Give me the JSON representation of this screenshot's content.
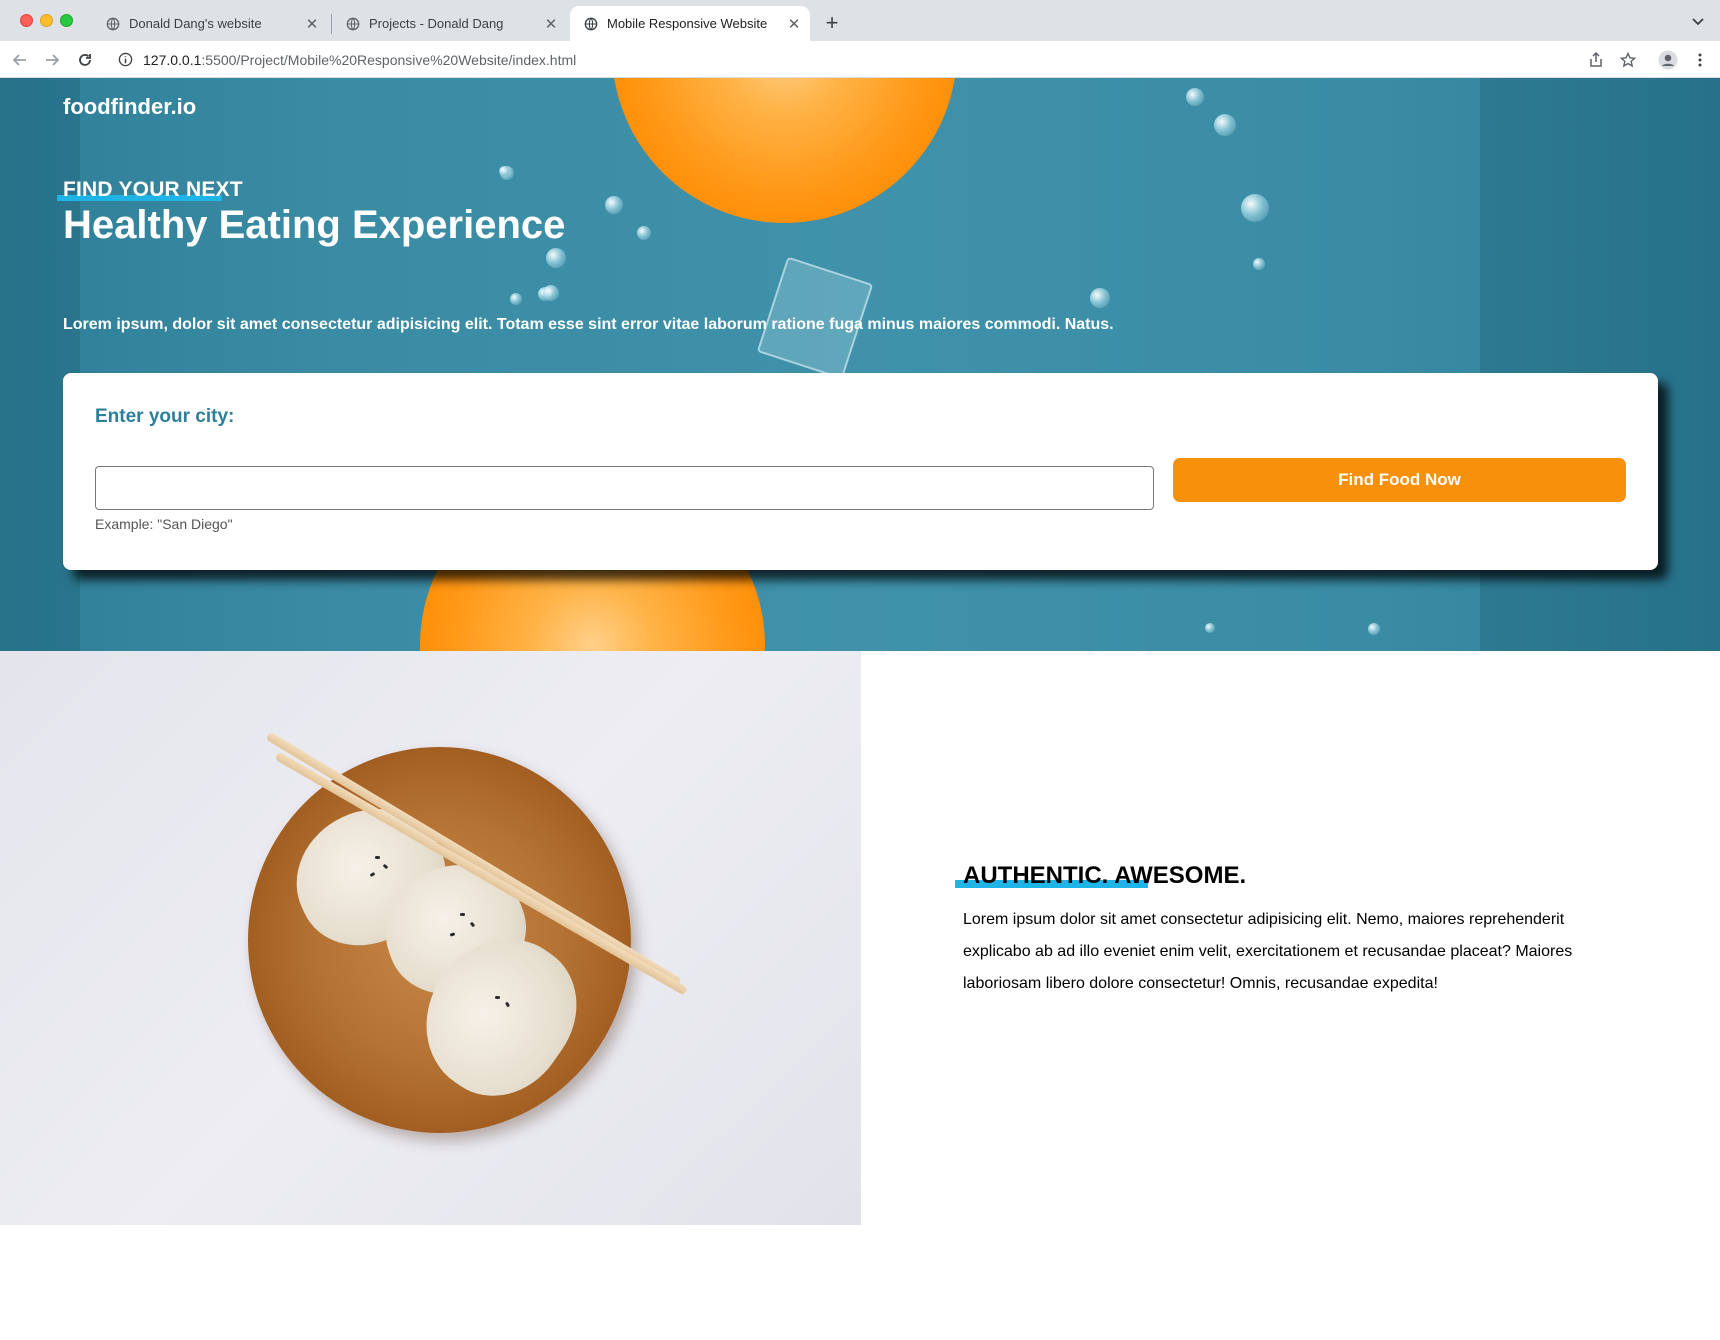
{
  "browser": {
    "tabs": [
      {
        "title": "Donald Dang's website",
        "active": false
      },
      {
        "title": "Projects - Donald Dang",
        "active": false
      },
      {
        "title": "Mobile Responsive Website",
        "active": true
      }
    ],
    "url_host": "127.0.0.1",
    "url_path": ":5500/Project/Mobile%20Responsive%20Website/index.html"
  },
  "hero": {
    "brand": "foodfinder.io",
    "kicker": "FIND YOUR NEXT",
    "title": "Healthy Eating Experience",
    "text": "Lorem ipsum, dolor sit amet consectetur adipisicing elit. Totam esse sint error vitae laborum ratione fuga minus maiores commodi. Natus."
  },
  "search": {
    "label": "Enter your city:",
    "value": "",
    "placeholder": "",
    "hint": "Example: \"San Diego\"",
    "button": "Find Food Now"
  },
  "feature": {
    "heading": "AUTHENTIC. AWESOME.",
    "text": "Lorem ipsum dolor sit amet consectetur adipisicing elit. Nemo, maiores reprehenderit explicabo ab ad illo eveniet enim velit, exercitationem et recusandae placeat? Maiores laboriosam libero dolore consectetur! Omnis, recusandae expedita!"
  },
  "colors": {
    "accent_blue": "#1fb4e8",
    "hero_teal": "#3f92aa",
    "button_orange": "#f7900a",
    "label_teal": "#2d7f9a"
  }
}
